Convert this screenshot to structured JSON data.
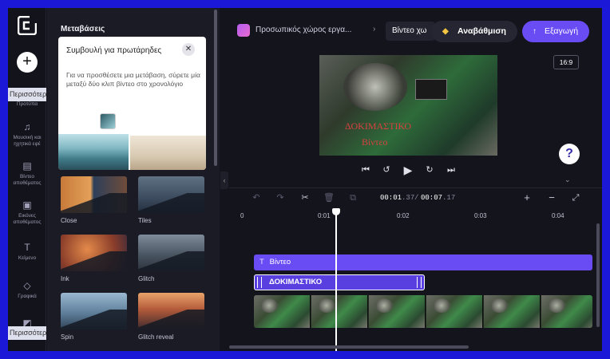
{
  "rail": {
    "more_label": "Περισσότερα",
    "items": [
      {
        "label": "Προτύπα",
        "icon": "template-icon"
      },
      {
        "label": "Μουσική και ηχητικά εφέ",
        "icon": "music-icon"
      },
      {
        "label": "Βίντεο αποθέματος",
        "icon": "film-icon"
      },
      {
        "label": "Εικόνες αποθέματος",
        "icon": "image-icon"
      },
      {
        "label": "Κείμενο",
        "icon": "text-icon"
      },
      {
        "label": "Γραφικά",
        "icon": "shapes-icon"
      }
    ]
  },
  "panel": {
    "title": "Μεταβάσεις",
    "tip": {
      "title": "Συμβουλή για πρωτάρηδες",
      "body": "Για να προσθέσετε μια μετάβαση, σύρετε μία μεταξύ δύο κλιπ βίντεο στο χρονολόγιο"
    },
    "transitions": [
      "Close",
      "Tiles",
      "Ink",
      "Glitch",
      "Spin",
      "Glitch reveal"
    ]
  },
  "topbar": {
    "workspace": "Προσωπικός χώρος εργα...",
    "project": "Βίντεο χω",
    "upgrade_label": "Αναβάθμιση",
    "export_label": "Εξαγωγή"
  },
  "preview": {
    "overlay_line1": "ΔΟΚΙΜΑΣΤΙΚΟ",
    "overlay_line2": "Βίντεο",
    "ratio": "16:9",
    "help": "?"
  },
  "timeline": {
    "current": "00:01",
    "current_frac": ".37",
    "total": "00:07",
    "total_frac": ".17",
    "ruler": [
      "0",
      "0:01",
      "0:02",
      "0:03",
      "0:04"
    ],
    "text_track": "Βίντεο",
    "title_track": "ΔΟΚΙΜΑΣΤΙΚΟ"
  },
  "colors": {
    "accent": "#6a4cf5",
    "frame": "#1c18d8",
    "overlay_text": "#d84040"
  }
}
